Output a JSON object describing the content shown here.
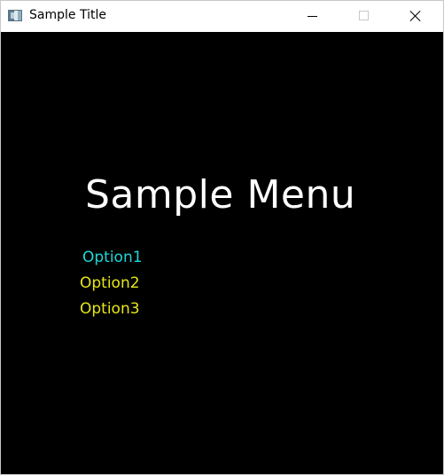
{
  "window": {
    "title": "Sample Title",
    "app_icon": "window-app-icon",
    "controls": {
      "minimize_icon": "minimize-icon",
      "maximize_icon": "maximize-icon",
      "close_icon": "close-icon"
    }
  },
  "menu": {
    "title": "Sample Menu",
    "options": [
      {
        "label": "Option1",
        "selected": true
      },
      {
        "label": "Option2",
        "selected": false
      },
      {
        "label": "Option3",
        "selected": false
      }
    ]
  },
  "colors": {
    "background": "#000000",
    "title_text": "#ffffff",
    "selected_option": "#1ed7d7",
    "option": "#e6e619"
  }
}
